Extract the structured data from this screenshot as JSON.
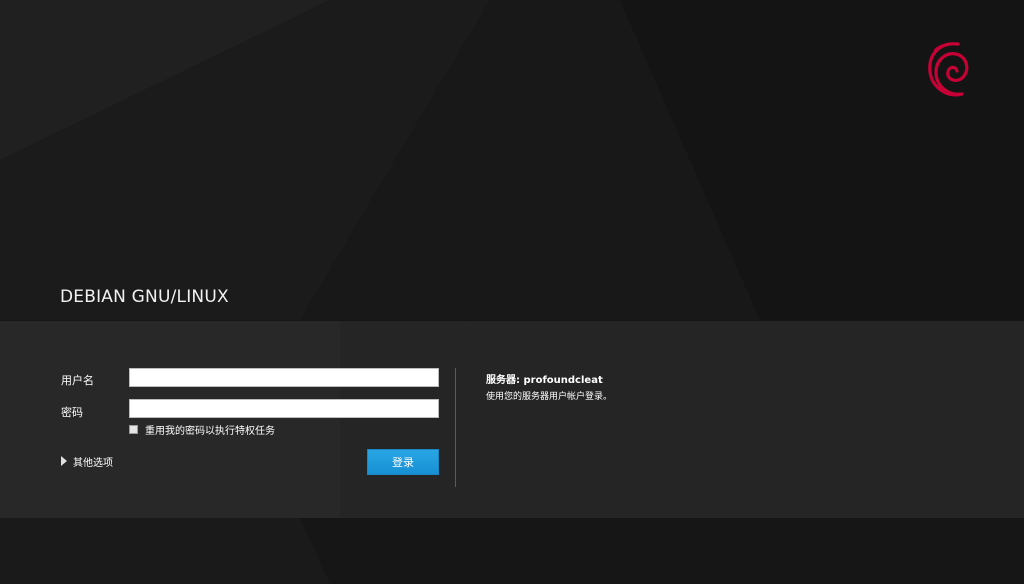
{
  "brand": {
    "title": "DEBIAN GNU/LINUX",
    "logo_icon": "debian-swirl-icon",
    "logo_color": "#c70036"
  },
  "login": {
    "username_label": "用户名",
    "username_value": "",
    "password_label": "密码",
    "password_value": "",
    "reuse_password_label": "重用我的密码以执行特权任务",
    "reuse_password_checked": false,
    "other_options_label": "其他选项",
    "submit_label": "登录"
  },
  "server_info": {
    "server_prefix": "服务器: ",
    "server_name": "profoundcleat",
    "hint": "使用您的服务器用户帐户登录。"
  },
  "colors": {
    "background": "#141414",
    "band": "#2d2d2d",
    "button": "#1f9ad9"
  }
}
